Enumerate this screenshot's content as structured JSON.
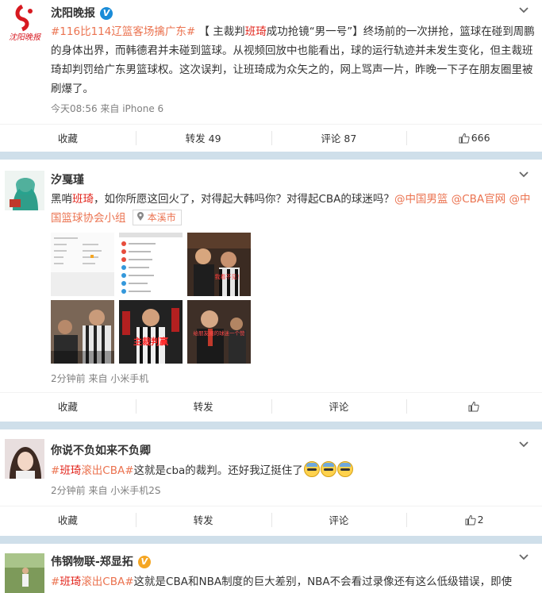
{
  "posts": [
    {
      "user": "沈阳晚报",
      "verified": "V",
      "badge_color": "#1a8cd8",
      "avatar_text": "沈阳晚报",
      "text_parts": {
        "topic": "#116比114辽篮客场擒广东#",
        "a": "【 主裁判",
        "hl": "班琦",
        "b": "成功抢镜“男一号”】终场前的一次拼抢，篮球在碰到周鹏的身体出界，而韩德君并未碰到篮球。从视频回放中也能看出，球的运行轨迹并未发生变化，但主裁班琦却判罚给广东男篮球权。这次误判，让班琦成为众矢之的，网上骂声一片，昨晚一下子在朋友圈里被刷爆了。"
      },
      "meta": "今天08:56 来自 iPhone 6",
      "actions": {
        "collect": "收藏",
        "repost": "转发 49",
        "comment": "评论 87",
        "like": "666"
      }
    },
    {
      "user": "汐戛瑾",
      "text_parts": {
        "a": "黑哨",
        "hl": "班琦",
        "b": "，如你所愿这回火了，对得起大韩吗你？对得起CBA的球迷吗？",
        "m1": "@中国男篮",
        "m2": "@CBA官网",
        "m3": "@中国篮球协会小组",
        "loc": "本溪市"
      },
      "image_captions": [
        "我看不见！",
        "主裁判赢",
        "给朋友圈的球迷一个赞"
      ],
      "meta": "2分钟前 来自 小米手机",
      "actions": {
        "collect": "收藏",
        "repost": "转发",
        "comment": "评论",
        "like": ""
      }
    },
    {
      "user": "你说不负如来不负卿",
      "text_parts": {
        "t1": "#",
        "hl": "班琦",
        "t2": "滚出CBA#",
        "b": "这就是cba的裁判。还好我辽挺住了"
      },
      "meta": "2分钟前 来自 小米手机2S",
      "actions": {
        "collect": "收藏",
        "repost": "转发",
        "comment": "评论",
        "like": "2"
      }
    },
    {
      "user": "伟钢物联-郑显拓",
      "verified": "V",
      "badge_color": "#f5a623",
      "text_parts": {
        "t1": "#",
        "hl": "班琦",
        "t2": "滚出CBA#",
        "b": "这就是CBA和NBA制度的巨大差别，NBA不会看过录像还有这么低级错误，即使"
      }
    }
  ]
}
